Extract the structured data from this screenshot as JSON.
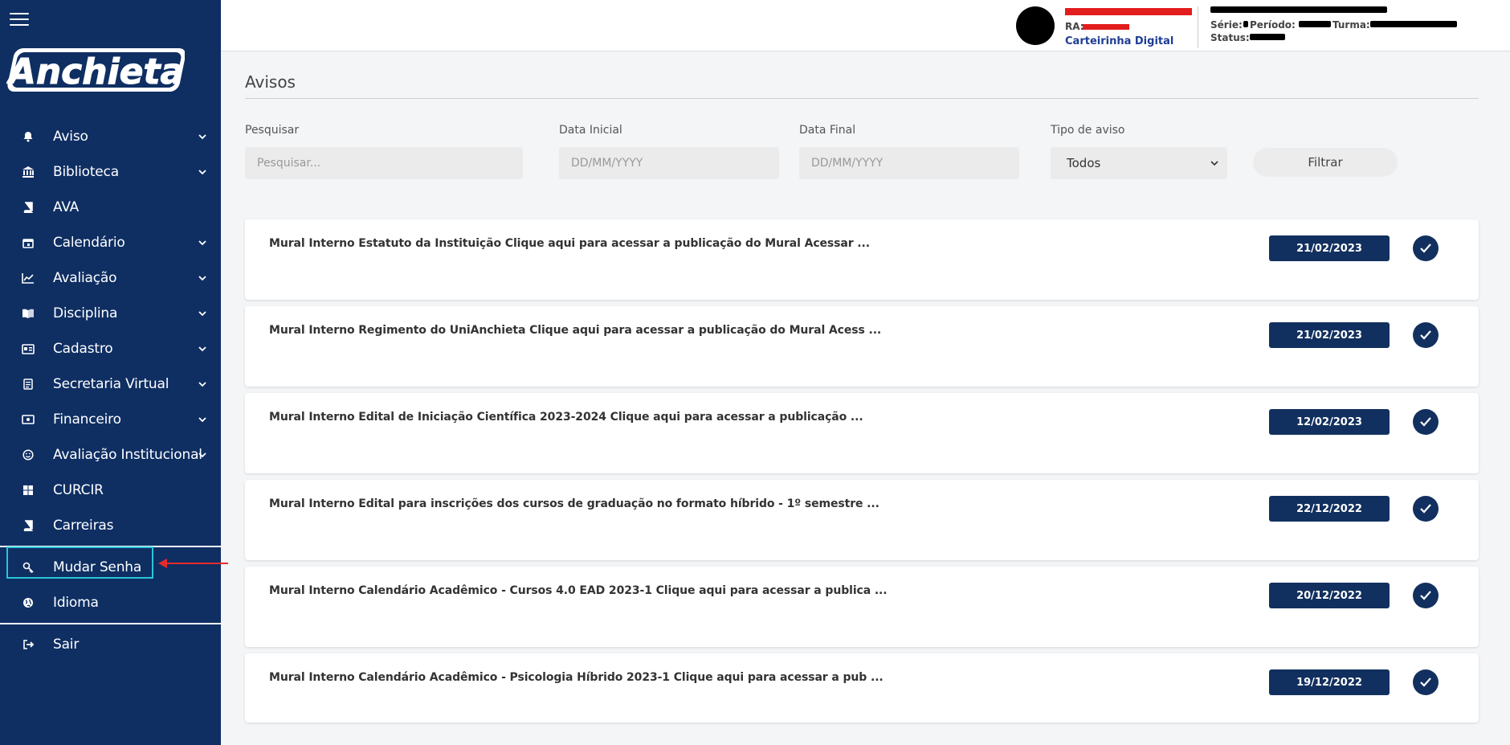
{
  "sidebar": {
    "logo_text": "Anchieta",
    "items": [
      {
        "label": "Aviso",
        "icon": "bell-icon",
        "has_submenu": true
      },
      {
        "label": "Biblioteca",
        "icon": "bank-icon",
        "has_submenu": true
      },
      {
        "label": "AVA",
        "icon": "book-icon",
        "has_submenu": false
      },
      {
        "label": "Calendário",
        "icon": "calendar-icon",
        "has_submenu": true
      },
      {
        "label": "Avaliação",
        "icon": "chart-line-icon",
        "has_submenu": true
      },
      {
        "label": "Disciplina",
        "icon": "book-open-icon",
        "has_submenu": true
      },
      {
        "label": "Cadastro",
        "icon": "id-card-icon",
        "has_submenu": true
      },
      {
        "label": "Secretaria Virtual",
        "icon": "document-icon",
        "has_submenu": true
      },
      {
        "label": "Financeiro",
        "icon": "money-icon",
        "has_submenu": true
      },
      {
        "label": "Avaliação Institucional",
        "icon": "smile-icon",
        "has_submenu": true
      },
      {
        "label": "CURCIR",
        "icon": "grid-icon",
        "has_submenu": false
      },
      {
        "label": "Carreiras",
        "icon": "book-icon",
        "has_submenu": false
      }
    ],
    "secondary": [
      {
        "label": "Mudar Senha",
        "icon": "key-icon"
      },
      {
        "label": "Idioma",
        "icon": "globe-icon"
      }
    ],
    "logout": {
      "label": "Sair",
      "icon": "sign-out-icon"
    }
  },
  "topbar": {
    "ra_label": "RA:",
    "card_link": "Carteirinha Digital",
    "serie_label": "Série:",
    "periodo_label": "Período:",
    "turma_label": "Turma:",
    "status_label": "Status:"
  },
  "main": {
    "title": "Avisos",
    "filters": {
      "search_label": "Pesquisar",
      "search_placeholder": "Pesquisar...",
      "start_label": "Data Inicial",
      "start_placeholder": "DD/MM/YYYY",
      "end_label": "Data Final",
      "end_placeholder": "DD/MM/YYYY",
      "type_label": "Tipo de aviso",
      "type_value": "Todos",
      "button_label": "Filtrar"
    },
    "notices": [
      {
        "text": "Mural Interno Estatuto da Instituição Clique aqui para acessar a publicação do Mural Acessar ...",
        "date": "21/02/2023"
      },
      {
        "text": "Mural Interno Regimento do UniAnchieta Clique aqui para acessar a publicação do Mural Acess ...",
        "date": "21/02/2023"
      },
      {
        "text": "Mural Interno Edital de Iniciação Científica 2023-2024 Clique aqui para acessar a publicação ...",
        "date": "12/02/2023"
      },
      {
        "text": "Mural Interno Edital para inscrições dos cursos de graduação no formato híbrido - 1º semestre ...",
        "date": "22/12/2022"
      },
      {
        "text": "Mural Interno Calendário Acadêmico - Cursos 4.0 EAD 2023-1 Clique aqui para acessar a publica ...",
        "date": "20/12/2022"
      },
      {
        "text": "Mural Interno Calendário Acadêmico - Psicologia Híbrido 2023-1 Clique aqui para acessar a pub ...",
        "date": "19/12/2022"
      }
    ]
  },
  "colors": {
    "sidebar_bg": "#0f2f63",
    "accent_navy": "#12305f",
    "highlight_cyan": "#28c6d9",
    "annotation_red": "#e52b2b",
    "link_blue": "#1e3e94"
  }
}
